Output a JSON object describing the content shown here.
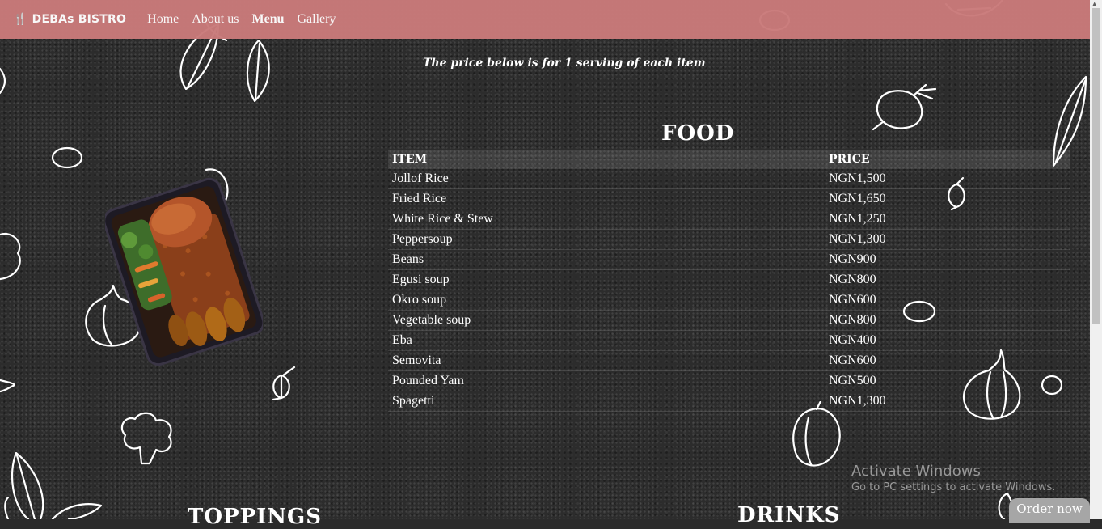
{
  "nav": {
    "brand_icon": "🍴",
    "brand": "DEBAs BISTRO",
    "links": [
      "Home",
      "About us",
      "Menu",
      "Gallery"
    ],
    "active": "Menu"
  },
  "note": "The price below is for 1 serving of each item",
  "food": {
    "title": "FOOD",
    "headers": [
      "ITEM",
      "PRICE"
    ],
    "rows": [
      [
        "Jollof Rice",
        "NGN1,500"
      ],
      [
        "Fried Rice",
        "NGN1,650"
      ],
      [
        "White Rice & Stew",
        "NGN1,250"
      ],
      [
        "Peppersoup",
        "NGN1,300"
      ],
      [
        "Beans",
        "NGN900"
      ],
      [
        "Egusi soup",
        "NGN800"
      ],
      [
        "Okro soup",
        "NGN600"
      ],
      [
        "Vegetable soup",
        "NGN800"
      ],
      [
        "Eba",
        "NGN400"
      ],
      [
        "Semovita",
        "NGN600"
      ],
      [
        "Pounded Yam",
        "NGN500"
      ],
      [
        "Spagetti",
        "NGN1,300"
      ]
    ]
  },
  "toppings_title": "TOPPINGS",
  "drinks_title": "DRINKS",
  "watermark": {
    "title": "Activate Windows",
    "subtitle": "Go to PC settings to activate Windows."
  },
  "order_button": "Order now",
  "colors": {
    "nav_bg": "#c97a7a",
    "page_bg": "#2c2c2c"
  }
}
